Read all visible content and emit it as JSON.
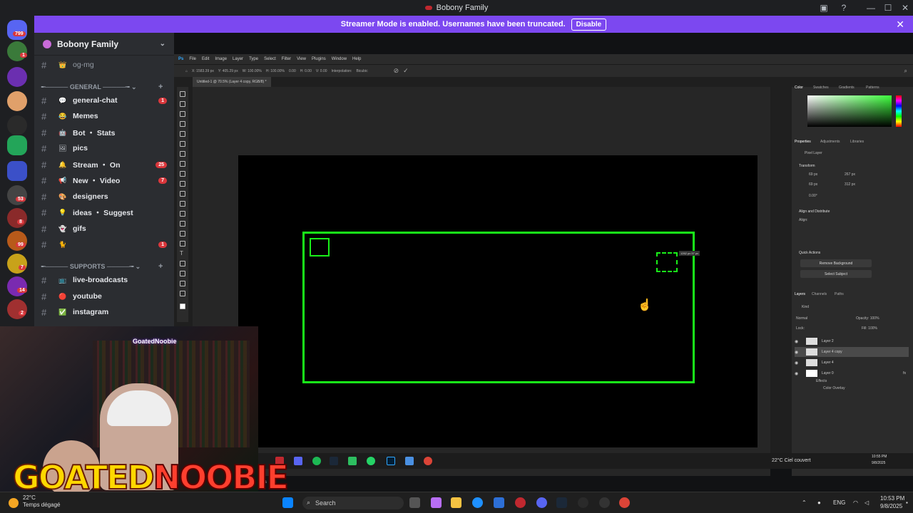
{
  "window": {
    "title": "Bobony Family"
  },
  "banner": {
    "text": "Streamer Mode is enabled. Usernames have been truncated.",
    "button": "Disable"
  },
  "rail": {
    "top_badge": "799",
    "badges": [
      "1",
      "53",
      "8",
      "99",
      "7",
      "14",
      "2"
    ]
  },
  "server": {
    "name": "Bobony Family"
  },
  "channels": [
    {
      "name": "og-mg",
      "emoji": "👑",
      "count": ""
    },
    {
      "name": "general-chat",
      "emoji": "💬",
      "count": "1"
    },
    {
      "name": "Memes",
      "emoji": "😂",
      "count": ""
    },
    {
      "name": "Bot ・ Stats",
      "emoji": "🤖",
      "count": ""
    },
    {
      "name": "pics",
      "emoji": "🖼",
      "count": ""
    },
    {
      "name": "Stream ・ On",
      "emoji": "🔔",
      "count": "25"
    },
    {
      "name": "New ・ Video",
      "emoji": "📢",
      "count": "7"
    },
    {
      "name": "designers",
      "emoji": "🎨",
      "count": ""
    },
    {
      "name": "ideas ・ Suggest",
      "emoji": "💡",
      "count": ""
    },
    {
      "name": "gifs",
      "emoji": "👻",
      "count": ""
    },
    {
      "name": "",
      "emoji": "🐈",
      "count": "1"
    },
    {
      "name": "live-broadcasts",
      "emoji": "📺",
      "count": ""
    },
    {
      "name": "youtube",
      "emoji": "🔴",
      "count": ""
    },
    {
      "name": "instagram",
      "emoji": "✅",
      "count": ""
    }
  ],
  "categories": {
    "general": "GENERAL",
    "supports": "SUPPORTS"
  },
  "photoshop": {
    "menu": [
      "Ps",
      "File",
      "Edit",
      "Image",
      "Layer",
      "Type",
      "Select",
      "Filter",
      "View",
      "Plugins",
      "Window",
      "Help"
    ],
    "options": [
      "X: 1583.39 px",
      "Y: 405.29 px",
      "W: 100.00%",
      "H: 100.00%",
      "0.00",
      "H: 0.00",
      "V: 0.00",
      "Interpolation:",
      "Bicubic"
    ],
    "doc_tab": "Untitled-1 @ 70.5% (Layer 4 copy, RGB/8) *",
    "selection_tip": "1262 px 57 px",
    "zoom": "70.5%",
    "panel_tabs": [
      "Color",
      "Swatches",
      "Gradients",
      "Patterns"
    ],
    "prop_tabs": [
      "Properties",
      "Adjustments",
      "Libraries"
    ],
    "pixel_layer": "Pixel Layer",
    "transform_label": "Transform",
    "w_val": "69 px",
    "h_val": "69 px",
    "x_val": "267 px",
    "y_val": "312 px",
    "angle": "0.00°",
    "align_label": "Align and Distribute",
    "align_sub": "Align:",
    "quick_actions": "Quick Actions",
    "remove_bg": "Remove Background",
    "select_subject": "Select Subject",
    "layer_tabs": [
      "Layers",
      "Channels",
      "Paths"
    ],
    "kind": "Kind",
    "blend": "Normal",
    "opacity": "Opacity: 100%",
    "lock": "Lock:",
    "fill": "Fill: 100%",
    "layers": [
      "Layer 2",
      "Layer 4 copy",
      "Layer 4",
      "Layer 0"
    ],
    "effects": "Effects",
    "color_overlay": "Color Overlay"
  },
  "inner_tray": {
    "weather": "22°C  Ciel couvert",
    "time": "10:55 PM",
    "date": "9/8/2025"
  },
  "cam": {
    "tag": "GoatedNoobie"
  },
  "logo": {
    "part1": "GOATED",
    "part2": "NOOBIE"
  },
  "taskbar": {
    "temp": "22°C",
    "weather": "Temps dégagé",
    "search": "Search",
    "lang": "ENG",
    "time": "10:53 PM",
    "date": "9/8/2025"
  }
}
